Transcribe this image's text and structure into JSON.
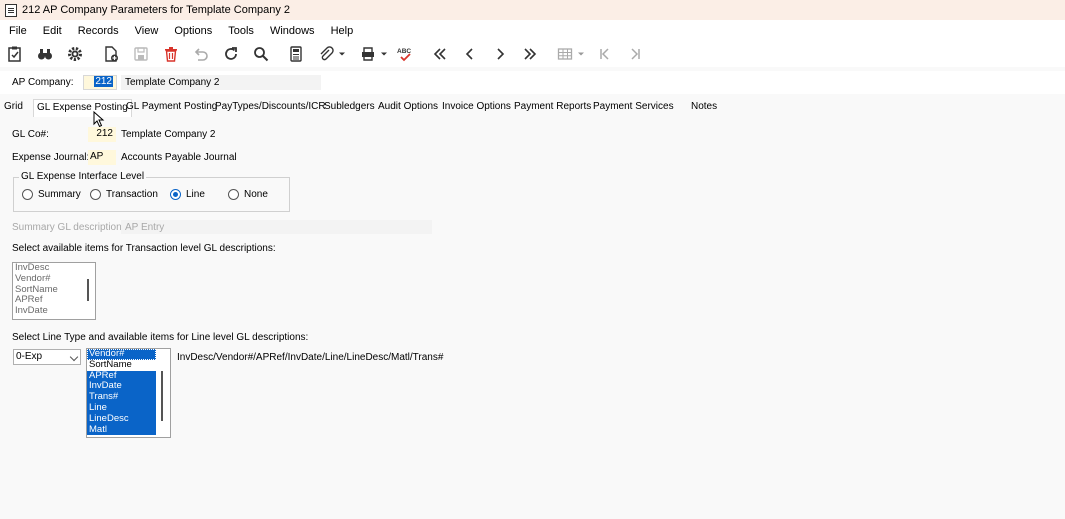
{
  "window": {
    "title": "212 AP Company Parameters for Template Company 2"
  },
  "menu": [
    "File",
    "Edit",
    "Records",
    "View",
    "Options",
    "Tools",
    "Windows",
    "Help"
  ],
  "toolbar_icons": [
    "new-record-icon",
    "find-icon",
    "settings-gear-icon",
    "new-document-icon",
    "save-icon",
    "delete-icon",
    "undo-icon",
    "refresh-icon",
    "search-icon",
    "calculator-icon",
    "attachment-icon",
    "print-icon",
    "spellcheck-icon",
    "first-record-icon",
    "previous-record-icon",
    "next-record-icon",
    "last-record-icon",
    "grid-view-icon",
    "first-page-icon",
    "last-page-icon"
  ],
  "header": {
    "ap_company_label": "AP Company:",
    "ap_company_code": "212",
    "ap_company_name": "Template Company 2"
  },
  "tabs": [
    "Grid",
    "GL Expense Posting",
    "GL Payment Posting",
    "PayTypes/Discounts/ICR",
    "Subledgers",
    "Audit Options",
    "Invoice Options",
    "Payment Reports",
    "Payment Services",
    "Notes"
  ],
  "active_tab": "GL Expense Posting",
  "form": {
    "gl_co_label": "GL Co#:",
    "gl_co_value": "212",
    "gl_co_name": "Template Company 2",
    "expense_journal_label": "Expense Journal:",
    "expense_journal_value": "AP",
    "expense_journal_name": "Accounts Payable Journal",
    "interface_level_legend": "GL Expense Interface Level",
    "interface_levels": [
      "Summary",
      "Transaction",
      "Line",
      "None"
    ],
    "interface_level_selected": "Line",
    "summary_desc_label": "Summary GL description:",
    "summary_desc_value": "AP Entry",
    "transaction_items_label": "Select available items for Transaction level GL descriptions:",
    "transaction_items": [
      "InvDesc",
      "Vendor#",
      "SortName",
      "APRef",
      "InvDate"
    ],
    "line_items_label": "Select Line Type and available items for Line level GL descriptions:",
    "line_type_selected": "0-Exp",
    "line_items": [
      "Vendor#",
      "SortName",
      "APRef",
      "InvDate",
      "Trans#",
      "Line",
      "LineDesc",
      "Matl"
    ],
    "line_items_selected": [
      "Vendor#",
      "APRef",
      "InvDate",
      "Trans#",
      "Line",
      "LineDesc",
      "Matl"
    ],
    "line_desc_preview": "InvDesc/Vendor#/APRef/InvDate/Line/LineDesc/Matl/Trans#"
  },
  "colors": {
    "title_bg": "#fbeee6",
    "selection": "#0a64c8",
    "delete_red": "#d9342b",
    "spell_red": "#d9342b",
    "field_yellow": "#fff8dc",
    "radio_checked": "#0a64c8"
  }
}
